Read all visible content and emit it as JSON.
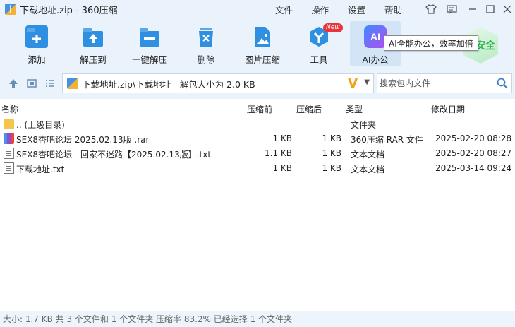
{
  "window": {
    "title": "下载地址.zip - 360压缩",
    "menu": [
      "文件",
      "操作",
      "设置",
      "帮助"
    ]
  },
  "toolbar": {
    "items": [
      {
        "label": "添加",
        "icon": "add-icon"
      },
      {
        "label": "解压到",
        "icon": "extract-to-icon"
      },
      {
        "label": "一键解压",
        "icon": "one-click-extract-icon"
      },
      {
        "label": "删除",
        "icon": "delete-icon"
      },
      {
        "label": "图片压缩",
        "icon": "image-compress-icon"
      },
      {
        "label": "工具",
        "icon": "tools-icon",
        "badge": "New"
      },
      {
        "label": "AI办公",
        "icon": "ai-icon"
      }
    ],
    "ai_icon_text": "AI",
    "tooltip": "AI全能办公，效率加倍",
    "safe_text": "安全"
  },
  "address": {
    "path": "下载地址.zip\\下载地址 - 解包大小为 2.0 KB",
    "search_placeholder": "搜索包内文件"
  },
  "columns": {
    "name": "名称",
    "packed": "压缩前",
    "compressed": "压缩后",
    "type": "类型",
    "modified": "修改日期"
  },
  "files": [
    {
      "name": ".. (上级目录)",
      "packed": "",
      "compressed": "",
      "type": "文件夹",
      "modified": "",
      "icon": "folder-icon"
    },
    {
      "name": "SEX8杏吧论坛  2025.02.13版 .rar",
      "packed": "1 KB",
      "compressed": "1 KB",
      "type": "360压缩 RAR 文件",
      "modified": "2025-02-20 08:28",
      "icon": "rar-file-icon"
    },
    {
      "name": "SEX8杏吧论坛 - 回家不迷路【2025.02.13版】.txt",
      "packed": "1.1 KB",
      "compressed": "1 KB",
      "type": "文本文档",
      "modified": "2025-02-20 08:27",
      "icon": "txt-file-icon"
    },
    {
      "name": "下载地址.txt",
      "packed": "1 KB",
      "compressed": "1 KB",
      "type": "文本文档",
      "modified": "2025-03-14 09:24",
      "icon": "txt-file-icon"
    }
  ],
  "status": "大小: 1.7 KB 共 3 个文件和 1 个文件夹 压缩率 83.2% 已经选择 1 个文件夹"
}
